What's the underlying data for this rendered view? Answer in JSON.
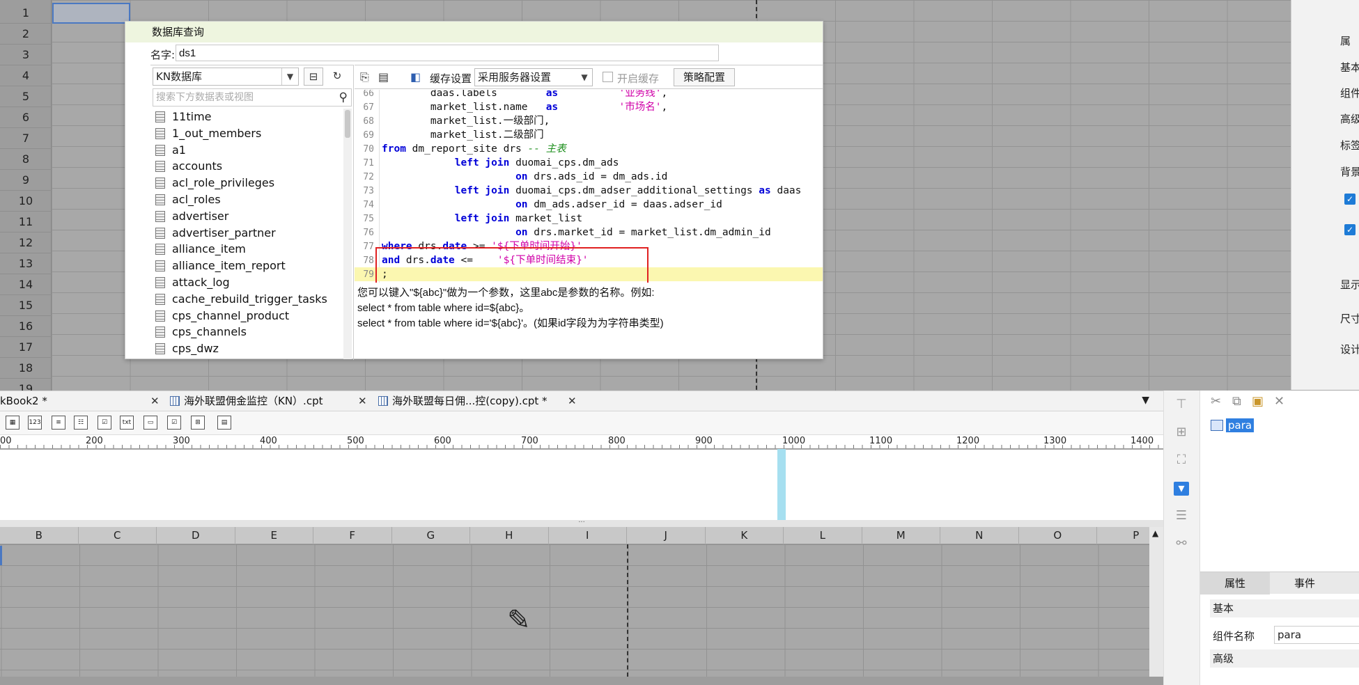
{
  "background": {
    "row_numbers": [
      "1",
      "2",
      "3",
      "4",
      "5",
      "6",
      "7",
      "8",
      "9",
      "10",
      "11",
      "12",
      "13",
      "14",
      "15",
      "16",
      "17",
      "18",
      "19"
    ],
    "right_panel": {
      "labels": [
        "属",
        "基本",
        "组件",
        "高级",
        "标签",
        "背景",
        "显示",
        "尺寸",
        "设计"
      ]
    }
  },
  "dialog": {
    "title": "数据库查询",
    "name_label": "名字:",
    "name_value": "ds1",
    "db_select": "KN数据库",
    "search_placeholder": "搜索下方数据表或视图",
    "tables": [
      "11time",
      "1_out_members",
      "a1",
      "accounts",
      "acl_role_privileges",
      "acl_roles",
      "advertiser",
      "advertiser_partner",
      "alliance_item",
      "alliance_item_report",
      "attack_log",
      "cache_rebuild_trigger_tasks",
      "cps_channel_product",
      "cps_channels",
      "cps_dwz"
    ],
    "cache_label": "缓存设置",
    "cache_select": "采用服务器设置",
    "cache_enable_label": "开启缓存",
    "policy_button": "策略配置",
    "code_lines": [
      {
        "ln": "66",
        "parts": [
          {
            "t": "        daas.labels        ",
            "c": "plain"
          },
          {
            "t": "as",
            "c": "kw"
          },
          {
            "t": "          ",
            "c": "plain"
          },
          {
            "t": "'业务线'",
            "c": "str"
          },
          {
            "t": ",",
            "c": "plain"
          }
        ]
      },
      {
        "ln": "67",
        "parts": [
          {
            "t": "        market_list.name   ",
            "c": "plain"
          },
          {
            "t": "as",
            "c": "kw"
          },
          {
            "t": "          ",
            "c": "plain"
          },
          {
            "t": "'市场名'",
            "c": "str"
          },
          {
            "t": ",",
            "c": "plain"
          }
        ]
      },
      {
        "ln": "68",
        "parts": [
          {
            "t": "        market_list.一级部门,",
            "c": "plain"
          }
        ]
      },
      {
        "ln": "69",
        "parts": [
          {
            "t": "        market_list.二级部门",
            "c": "plain"
          }
        ]
      },
      {
        "ln": "70",
        "parts": [
          {
            "t": "from",
            "c": "kw"
          },
          {
            "t": " dm_report_site drs ",
            "c": "plain"
          },
          {
            "t": "-- 主表",
            "c": "cmt"
          }
        ]
      },
      {
        "ln": "71",
        "parts": [
          {
            "t": "            ",
            "c": "plain"
          },
          {
            "t": "left join",
            "c": "kw"
          },
          {
            "t": " duomai_cps.dm_ads",
            "c": "plain"
          }
        ]
      },
      {
        "ln": "72",
        "parts": [
          {
            "t": "                      ",
            "c": "plain"
          },
          {
            "t": "on",
            "c": "kw"
          },
          {
            "t": " drs.ads_id = dm_ads.id",
            "c": "plain"
          }
        ]
      },
      {
        "ln": "73",
        "parts": [
          {
            "t": "            ",
            "c": "plain"
          },
          {
            "t": "left join",
            "c": "kw"
          },
          {
            "t": " duomai_cps.dm_adser_additional_settings ",
            "c": "plain"
          },
          {
            "t": "as",
            "c": "kw"
          },
          {
            "t": " daas",
            "c": "plain"
          }
        ]
      },
      {
        "ln": "74",
        "parts": [
          {
            "t": "                      ",
            "c": "plain"
          },
          {
            "t": "on",
            "c": "kw"
          },
          {
            "t": " dm_ads.adser_id = daas.adser_id",
            "c": "plain"
          }
        ]
      },
      {
        "ln": "75",
        "parts": [
          {
            "t": "            ",
            "c": "plain"
          },
          {
            "t": "left join",
            "c": "kw"
          },
          {
            "t": " market_list",
            "c": "plain"
          }
        ]
      },
      {
        "ln": "76",
        "parts": [
          {
            "t": "                      ",
            "c": "plain"
          },
          {
            "t": "on",
            "c": "kw"
          },
          {
            "t": " drs.market_id = market_list.dm_admin_id",
            "c": "plain"
          }
        ]
      },
      {
        "ln": "77",
        "parts": [
          {
            "t": "where",
            "c": "kw"
          },
          {
            "t": " drs.",
            "c": "plain"
          },
          {
            "t": "date",
            "c": "kw"
          },
          {
            "t": " >= ",
            "c": "plain"
          },
          {
            "t": "'${下单时间开始}'",
            "c": "str"
          }
        ]
      },
      {
        "ln": "78",
        "parts": [
          {
            "t": "and",
            "c": "kw"
          },
          {
            "t": " drs.",
            "c": "plain"
          },
          {
            "t": "date",
            "c": "kw"
          },
          {
            "t": " <=    ",
            "c": "plain"
          },
          {
            "t": "'${下单时间结束}'",
            "c": "str"
          }
        ]
      },
      {
        "ln": "79",
        "parts": [
          {
            "t": ";",
            "c": "plain"
          }
        ],
        "highlight": true
      }
    ],
    "hint_lines": [
      "您可以键入\"${abc}\"做为一个参数，这里abc是参数的名称。例如:",
      "select * from table where id=${abc}。",
      "select * from table where id='${abc}'。(如果id字段为为字符串类型)"
    ]
  },
  "tabs": [
    {
      "label": "kBook2 *",
      "close": "✕"
    },
    {
      "label": "海外联盟佣金监控（KN）.cpt",
      "close": "✕"
    },
    {
      "label": "海外联盟每日佣...控(copy).cpt *",
      "close": "✕"
    }
  ],
  "toolbar2": [
    "▦",
    "123",
    "≡",
    "☷",
    "☑",
    "txt",
    "▭",
    "☑",
    "⊞",
    "▤"
  ],
  "ruler_labels": [
    "00",
    "200",
    "300",
    "400",
    "500",
    "600",
    "700",
    "800",
    "900",
    "1000",
    "1100",
    "1200",
    "1300",
    "1400"
  ],
  "columns": [
    "B",
    "C",
    "D",
    "E",
    "F",
    "G",
    "H",
    "I",
    "J",
    "K",
    "L",
    "M",
    "N",
    "O",
    "P"
  ],
  "widget_panel": {
    "tree_item": "para",
    "tabs": [
      "属性",
      "事件"
    ],
    "section_basic": "基本",
    "name_label": "组件名称",
    "name_value": "para",
    "section_advanced": "高级"
  },
  "colors": {
    "accent": "#2f7fe0",
    "keyword": "#0000d8",
    "string": "#d000a8",
    "comment": "#1d8f1d",
    "red_box": "#e02020"
  }
}
